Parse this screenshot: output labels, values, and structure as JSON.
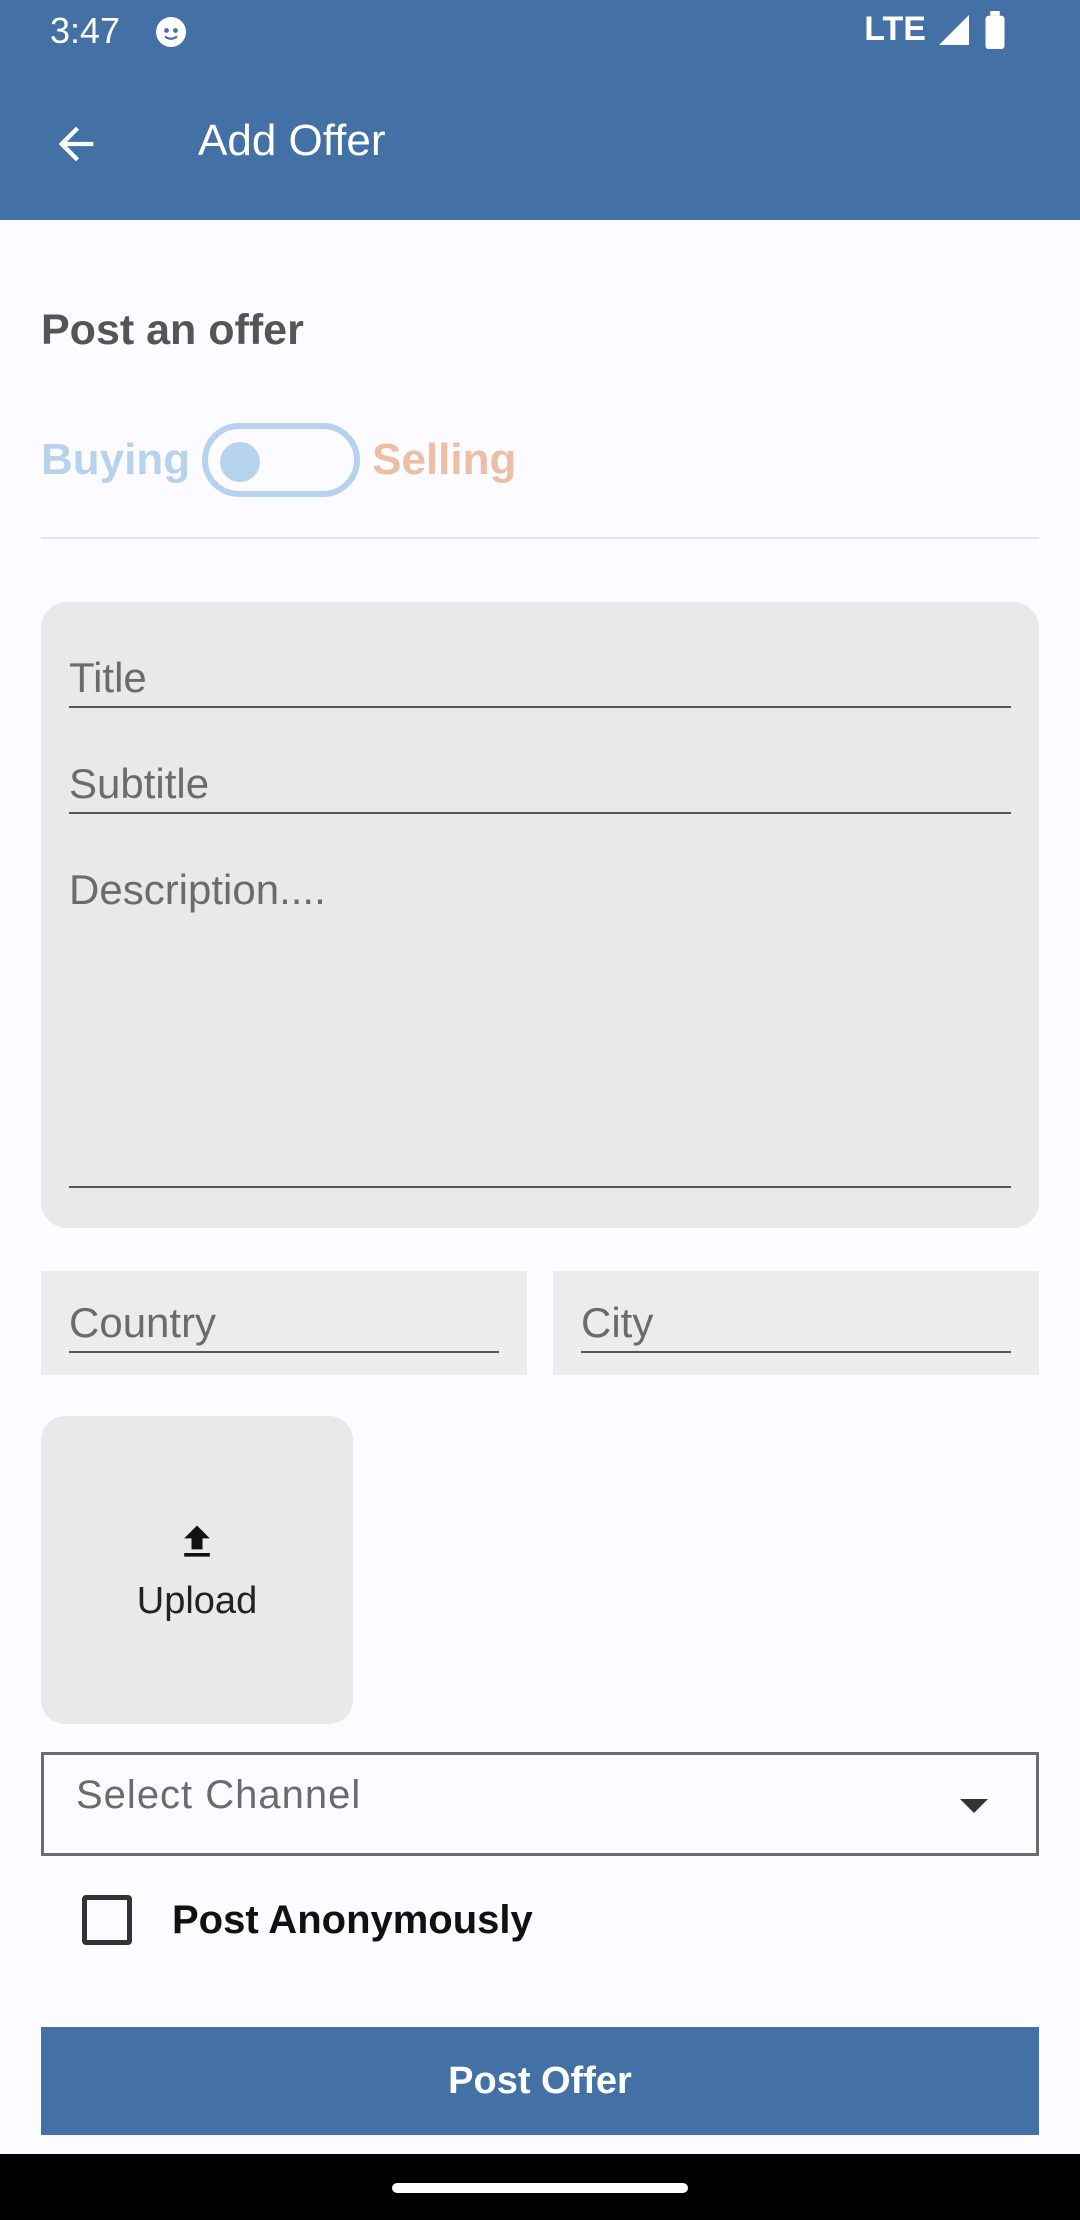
{
  "status_bar": {
    "time": "3:47",
    "network": "LTE"
  },
  "app_bar": {
    "title": "Add Offer"
  },
  "form": {
    "section_title": "Post an offer",
    "toggle_left": "Buying",
    "toggle_right": "Selling",
    "title_placeholder": "Title",
    "subtitle_placeholder": "Subtitle",
    "description_placeholder": "Description....",
    "country_placeholder": "Country",
    "city_placeholder": "City",
    "upload_label": "Upload",
    "select_channel": "Select Channel",
    "anonymous_label": "Post Anonymously",
    "submit_label": "Post Offer"
  },
  "colors": {
    "primary": "#4370a5",
    "buying": "#b7d2ec",
    "selling": "#ebbfa6",
    "field_bg": "#e9e9e9"
  }
}
